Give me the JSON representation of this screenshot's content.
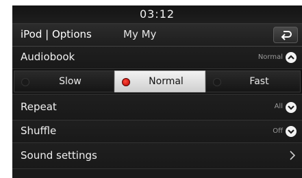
{
  "status": {
    "time": "03:12"
  },
  "header": {
    "title": "iPod | Options",
    "song": "My My"
  },
  "options": {
    "audiobook": {
      "label": "Audiobook",
      "value": "Normal"
    },
    "speeds": [
      "Slow",
      "Normal",
      "Fast"
    ],
    "speed_selected": "Normal",
    "repeat": {
      "label": "Repeat",
      "value": "All"
    },
    "shuffle": {
      "label": "Shuffle",
      "value": "Off"
    },
    "sound": {
      "label": "Sound settings"
    }
  },
  "icons": {
    "back": "back-arrow-icon",
    "collapse": "chevron-up-icon",
    "expand": "chevron-down-icon",
    "submenu": "chevron-right-icon"
  },
  "colors": {
    "background": "#1a1a1a",
    "selected": "#e8e8e8",
    "radio_active": "#d01010"
  }
}
